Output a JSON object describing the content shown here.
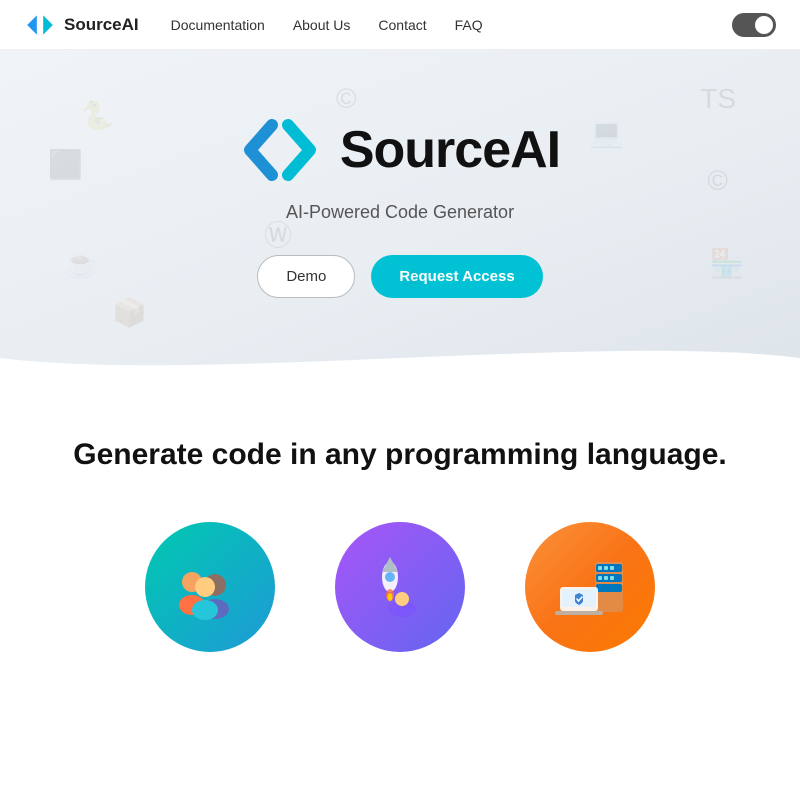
{
  "nav": {
    "brand_name": "SourceAI",
    "links": [
      {
        "label": "Documentation",
        "id": "documentation"
      },
      {
        "label": "About Us",
        "id": "about-us"
      },
      {
        "label": "Contact",
        "id": "contact"
      },
      {
        "label": "FAQ",
        "id": "faq"
      }
    ]
  },
  "hero": {
    "title": "SourceAI",
    "subtitle": "AI-Powered Code Generator",
    "demo_label": "Demo",
    "access_label": "Request Access"
  },
  "section": {
    "headline": "Generate code in any programming language.",
    "features": [
      {
        "id": "team",
        "emoji": "👥",
        "color_class": "circle-teal"
      },
      {
        "id": "rocket",
        "emoji": "🚀",
        "color_class": "circle-purple"
      },
      {
        "id": "server",
        "emoji": "🖥️",
        "color_class": "circle-orange"
      }
    ]
  }
}
